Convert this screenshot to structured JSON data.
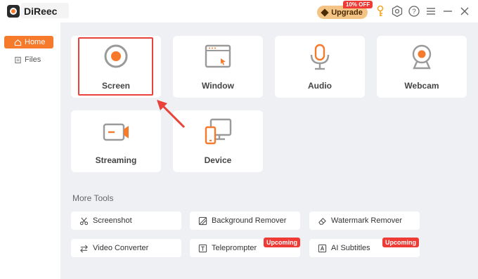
{
  "app": {
    "name": "DiReec"
  },
  "titlebar": {
    "upgrade_label": "Upgrade",
    "discount_badge": "10% OFF",
    "icons": [
      "key-icon",
      "settings-icon",
      "help-icon",
      "menu-icon",
      "minimize-icon",
      "close-icon"
    ]
  },
  "sidebar": {
    "items": [
      {
        "label": "Home",
        "icon": "home-icon",
        "active": true
      },
      {
        "label": "Files",
        "icon": "file-icon",
        "active": false
      }
    ]
  },
  "modes": [
    {
      "label": "Screen",
      "icon": "record-icon",
      "highlighted": true
    },
    {
      "label": "Window",
      "icon": "window-icon"
    },
    {
      "label": "Audio",
      "icon": "microphone-icon"
    },
    {
      "label": "Webcam",
      "icon": "webcam-icon"
    },
    {
      "label": "Streaming",
      "icon": "camera-icon"
    },
    {
      "label": "Device",
      "icon": "devices-icon"
    }
  ],
  "more_tools": {
    "title": "More Tools",
    "items": [
      {
        "label": "Screenshot",
        "icon": "scissors-icon"
      },
      {
        "label": "Background Remover",
        "icon": "image-icon"
      },
      {
        "label": "Watermark Remover",
        "icon": "eraser-icon"
      },
      {
        "label": "Video Converter",
        "icon": "convert-icon"
      },
      {
        "label": "Teleprompter",
        "icon": "text-icon",
        "badge": "Upcoming"
      },
      {
        "label": "AI Subtitles",
        "icon": "subtitle-icon",
        "badge": "Upcoming"
      }
    ]
  },
  "colors": {
    "accent": "#f57a2b",
    "highlight": "#e8423a",
    "badge": "#ef3b36",
    "upgrade": "#f4c486"
  }
}
